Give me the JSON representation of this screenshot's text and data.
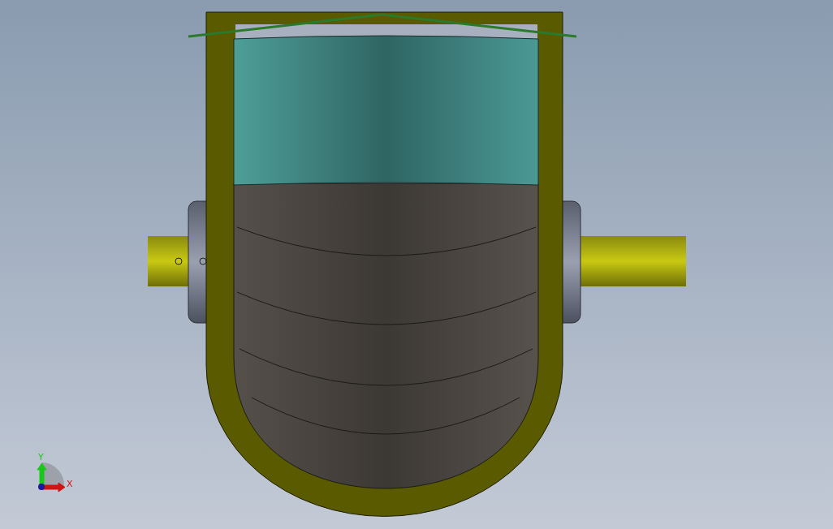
{
  "viewport": {
    "triad": {
      "axes": [
        {
          "label": "Y",
          "color": "#19c819"
        },
        {
          "label": "X",
          "color": "#d01414"
        }
      ]
    }
  }
}
